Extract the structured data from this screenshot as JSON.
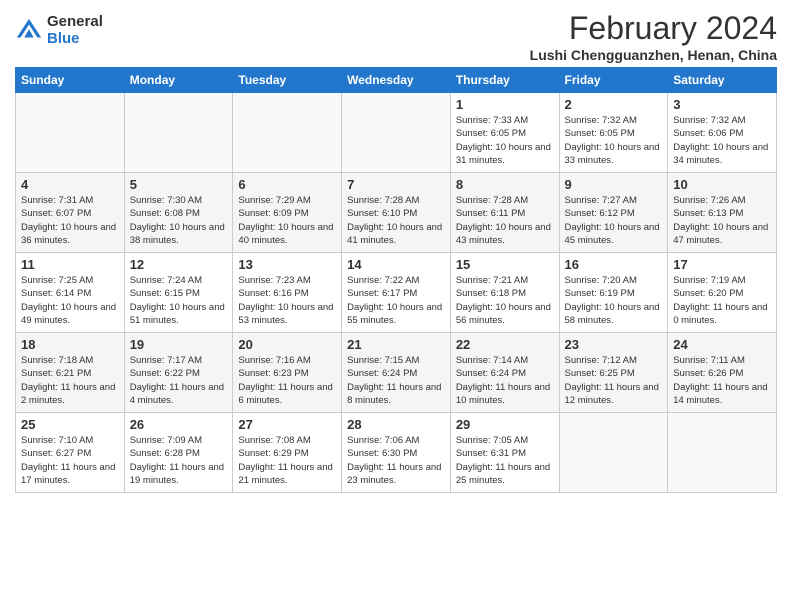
{
  "logo": {
    "general": "General",
    "blue": "Blue"
  },
  "title": "February 2024",
  "location": "Lushi Chengguanzhen, Henan, China",
  "weekdays": [
    "Sunday",
    "Monday",
    "Tuesday",
    "Wednesday",
    "Thursday",
    "Friday",
    "Saturday"
  ],
  "weeks": [
    [
      {
        "day": "",
        "sunrise": "",
        "sunset": "",
        "daylight": ""
      },
      {
        "day": "",
        "sunrise": "",
        "sunset": "",
        "daylight": ""
      },
      {
        "day": "",
        "sunrise": "",
        "sunset": "",
        "daylight": ""
      },
      {
        "day": "",
        "sunrise": "",
        "sunset": "",
        "daylight": ""
      },
      {
        "day": "1",
        "sunrise": "Sunrise: 7:33 AM",
        "sunset": "Sunset: 6:05 PM",
        "daylight": "Daylight: 10 hours and 31 minutes."
      },
      {
        "day": "2",
        "sunrise": "Sunrise: 7:32 AM",
        "sunset": "Sunset: 6:05 PM",
        "daylight": "Daylight: 10 hours and 33 minutes."
      },
      {
        "day": "3",
        "sunrise": "Sunrise: 7:32 AM",
        "sunset": "Sunset: 6:06 PM",
        "daylight": "Daylight: 10 hours and 34 minutes."
      }
    ],
    [
      {
        "day": "4",
        "sunrise": "Sunrise: 7:31 AM",
        "sunset": "Sunset: 6:07 PM",
        "daylight": "Daylight: 10 hours and 36 minutes."
      },
      {
        "day": "5",
        "sunrise": "Sunrise: 7:30 AM",
        "sunset": "Sunset: 6:08 PM",
        "daylight": "Daylight: 10 hours and 38 minutes."
      },
      {
        "day": "6",
        "sunrise": "Sunrise: 7:29 AM",
        "sunset": "Sunset: 6:09 PM",
        "daylight": "Daylight: 10 hours and 40 minutes."
      },
      {
        "day": "7",
        "sunrise": "Sunrise: 7:28 AM",
        "sunset": "Sunset: 6:10 PM",
        "daylight": "Daylight: 10 hours and 41 minutes."
      },
      {
        "day": "8",
        "sunrise": "Sunrise: 7:28 AM",
        "sunset": "Sunset: 6:11 PM",
        "daylight": "Daylight: 10 hours and 43 minutes."
      },
      {
        "day": "9",
        "sunrise": "Sunrise: 7:27 AM",
        "sunset": "Sunset: 6:12 PM",
        "daylight": "Daylight: 10 hours and 45 minutes."
      },
      {
        "day": "10",
        "sunrise": "Sunrise: 7:26 AM",
        "sunset": "Sunset: 6:13 PM",
        "daylight": "Daylight: 10 hours and 47 minutes."
      }
    ],
    [
      {
        "day": "11",
        "sunrise": "Sunrise: 7:25 AM",
        "sunset": "Sunset: 6:14 PM",
        "daylight": "Daylight: 10 hours and 49 minutes."
      },
      {
        "day": "12",
        "sunrise": "Sunrise: 7:24 AM",
        "sunset": "Sunset: 6:15 PM",
        "daylight": "Daylight: 10 hours and 51 minutes."
      },
      {
        "day": "13",
        "sunrise": "Sunrise: 7:23 AM",
        "sunset": "Sunset: 6:16 PM",
        "daylight": "Daylight: 10 hours and 53 minutes."
      },
      {
        "day": "14",
        "sunrise": "Sunrise: 7:22 AM",
        "sunset": "Sunset: 6:17 PM",
        "daylight": "Daylight: 10 hours and 55 minutes."
      },
      {
        "day": "15",
        "sunrise": "Sunrise: 7:21 AM",
        "sunset": "Sunset: 6:18 PM",
        "daylight": "Daylight: 10 hours and 56 minutes."
      },
      {
        "day": "16",
        "sunrise": "Sunrise: 7:20 AM",
        "sunset": "Sunset: 6:19 PM",
        "daylight": "Daylight: 10 hours and 58 minutes."
      },
      {
        "day": "17",
        "sunrise": "Sunrise: 7:19 AM",
        "sunset": "Sunset: 6:20 PM",
        "daylight": "Daylight: 11 hours and 0 minutes."
      }
    ],
    [
      {
        "day": "18",
        "sunrise": "Sunrise: 7:18 AM",
        "sunset": "Sunset: 6:21 PM",
        "daylight": "Daylight: 11 hours and 2 minutes."
      },
      {
        "day": "19",
        "sunrise": "Sunrise: 7:17 AM",
        "sunset": "Sunset: 6:22 PM",
        "daylight": "Daylight: 11 hours and 4 minutes."
      },
      {
        "day": "20",
        "sunrise": "Sunrise: 7:16 AM",
        "sunset": "Sunset: 6:23 PM",
        "daylight": "Daylight: 11 hours and 6 minutes."
      },
      {
        "day": "21",
        "sunrise": "Sunrise: 7:15 AM",
        "sunset": "Sunset: 6:24 PM",
        "daylight": "Daylight: 11 hours and 8 minutes."
      },
      {
        "day": "22",
        "sunrise": "Sunrise: 7:14 AM",
        "sunset": "Sunset: 6:24 PM",
        "daylight": "Daylight: 11 hours and 10 minutes."
      },
      {
        "day": "23",
        "sunrise": "Sunrise: 7:12 AM",
        "sunset": "Sunset: 6:25 PM",
        "daylight": "Daylight: 11 hours and 12 minutes."
      },
      {
        "day": "24",
        "sunrise": "Sunrise: 7:11 AM",
        "sunset": "Sunset: 6:26 PM",
        "daylight": "Daylight: 11 hours and 14 minutes."
      }
    ],
    [
      {
        "day": "25",
        "sunrise": "Sunrise: 7:10 AM",
        "sunset": "Sunset: 6:27 PM",
        "daylight": "Daylight: 11 hours and 17 minutes."
      },
      {
        "day": "26",
        "sunrise": "Sunrise: 7:09 AM",
        "sunset": "Sunset: 6:28 PM",
        "daylight": "Daylight: 11 hours and 19 minutes."
      },
      {
        "day": "27",
        "sunrise": "Sunrise: 7:08 AM",
        "sunset": "Sunset: 6:29 PM",
        "daylight": "Daylight: 11 hours and 21 minutes."
      },
      {
        "day": "28",
        "sunrise": "Sunrise: 7:06 AM",
        "sunset": "Sunset: 6:30 PM",
        "daylight": "Daylight: 11 hours and 23 minutes."
      },
      {
        "day": "29",
        "sunrise": "Sunrise: 7:05 AM",
        "sunset": "Sunset: 6:31 PM",
        "daylight": "Daylight: 11 hours and 25 minutes."
      },
      {
        "day": "",
        "sunrise": "",
        "sunset": "",
        "daylight": ""
      },
      {
        "day": "",
        "sunrise": "",
        "sunset": "",
        "daylight": ""
      }
    ]
  ]
}
